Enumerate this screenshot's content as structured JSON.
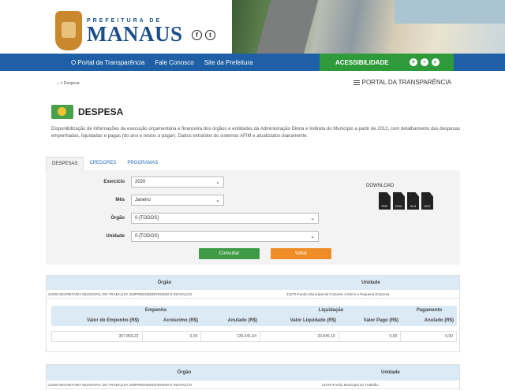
{
  "header": {
    "brand_top": "PREFEITURA DE",
    "brand_city": "MANAUS",
    "social": [
      "f",
      "t"
    ]
  },
  "nav": {
    "items": [
      "O Portal da Transparência",
      "Fale Conosco",
      "Site da Prefeitura"
    ],
    "accessibility": "ACESSIBILIDADE",
    "access_icons": [
      "+",
      "−",
      "◐"
    ]
  },
  "breadcrumb": {
    "home_icon": "home-icon",
    "separator": ">",
    "current": "Despesa"
  },
  "portal_menu": "PORTAL DA TRANSPARÊNCIA",
  "page": {
    "title": "DESPESA",
    "description": "Disponibilização de informações da execução orçamentária e financeira dos órgãos e entidades da Administração Direta e Indireta do Município a partir de 2012, com detalhamento das despesas empenhadas, liquidadas e pagas (do ano e restos a pagar). Dados extraídos do sistemas AFIM e atualizados diariamente."
  },
  "tabs": [
    "DESPESAS",
    "CREDORES",
    "PROGRAMAS"
  ],
  "filters": {
    "exercicio": {
      "label": "Exercício",
      "value": "2020"
    },
    "mes": {
      "label": "Mês",
      "value": "Janeiro"
    },
    "orgao": {
      "label": "Órgão",
      "value": "0-[TODOS]"
    },
    "unidade": {
      "label": "Unidade",
      "value": "0-[TODOS]"
    },
    "consultar": "Consultar",
    "voltar": "Voltar"
  },
  "download": {
    "label": "DOWNLOAD",
    "files": [
      "PDF",
      "DOC",
      "XLS",
      "ODT"
    ]
  },
  "results": [
    {
      "orgao_header": "Órgão",
      "unidade_header": "Unidade",
      "orgao": "21000-SECRETARIA MUNICIPAL DO TRABALHO, EMPREENDEDORISMO E INOVAÇÃO",
      "unidade": "21070-Fundo Municipal de Fomento à Micro e Pequena Empresa",
      "groups": {
        "empenho": "Empenho",
        "liquidacao": "Liquidação",
        "pagamento": "Pagamento"
      },
      "columns": [
        "Valor do Empenho (R$)",
        "Acréscimo (R$)",
        "Anulado (R$)",
        "Valor Liquidado (R$)",
        "Valor Pago (R$)",
        "Anulado (R$)"
      ],
      "values": [
        "357.869,22",
        "0,00",
        "135.341,64",
        "33.846,10",
        "0,00",
        "0,00"
      ]
    },
    {
      "orgao_header": "Órgão",
      "unidade_header": "Unidade",
      "orgao": "21000-SECRETARIA MUNICIPAL DO TRABALHO, EMPREENDEDORISMO E INOVAÇÃO",
      "unidade": "21070-Fundo Municipal do Trabalho"
    }
  ],
  "colors": {
    "nav": "#1f5fa6",
    "access": "#2e9a3a",
    "consultar": "#3f9a45",
    "voltar": "#ef8e26",
    "table_head": "#dceaf6"
  }
}
